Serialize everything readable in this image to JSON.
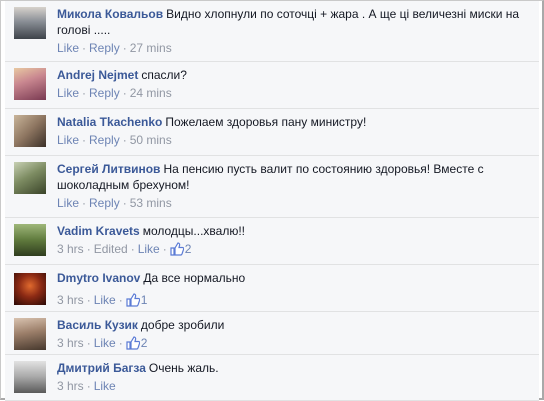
{
  "comments": [
    {
      "author": "Микола Ковальов",
      "text": "Видно хлопнули по соточці + жара . А ще ці величезні миски на голові .....",
      "meta": {
        "like": "Like",
        "reply": "Reply",
        "time": "27 mins"
      },
      "avatar_color": "#5a5f68",
      "avatar_icon": "person-photo-icon"
    },
    {
      "author": "Andrej Nejmet",
      "text": "спасли?",
      "meta": {
        "like": "Like",
        "reply": "Reply",
        "time": "24 mins"
      },
      "avatar_color": "#b56c7d",
      "avatar_icon": "person-photo-icon"
    },
    {
      "author": "Natalia Tkachenko",
      "text": "Пожелаем здоровья пану министру!",
      "meta": {
        "like": "Like",
        "reply": "Reply",
        "time": "50 mins"
      },
      "avatar_color": "#7c6a59",
      "avatar_icon": "person-photo-icon"
    },
    {
      "author": "Сергей Литвинов",
      "text": "На пенсию пусть валит по состоянию здоровья! Вместе с шоколадным брехуном!",
      "meta": {
        "like": "Like",
        "reply": "Reply",
        "time": "53 mins"
      },
      "avatar_color": "#6b7c55",
      "avatar_icon": "person-photo-icon"
    },
    {
      "author": "Vadim Kravets",
      "text": "молодцы...хвалю!!",
      "meta": {
        "time": "3 hrs",
        "edited": "Edited",
        "like": "Like",
        "like_count": "2"
      },
      "avatar_color": "#5f7a3d",
      "avatar_icon": "person-photo-icon"
    },
    {
      "author": "Dmytro Ivanov",
      "text": "Да все нормально",
      "meta": {
        "time": "3 hrs",
        "like": "Like",
        "like_count": "1"
      },
      "avatar_color": "#8c2a14",
      "avatar_icon": "person-photo-icon"
    },
    {
      "author": "Василь Кузик",
      "text": "добре зробили",
      "meta": {
        "time": "3 hrs",
        "like": "Like",
        "like_count": "2"
      },
      "avatar_color": "#6e5c4e",
      "avatar_icon": "person-photo-icon"
    },
    {
      "author": "Дмитрий Багза",
      "text": "Очень жаль.",
      "meta": {
        "time": "3 hrs",
        "like": "Like"
      },
      "avatar_color": "#9a9a9a",
      "avatar_icon": "person-photo-icon"
    }
  ],
  "colors": {
    "author_link": "#3b5998",
    "action_link": "#6d84b4",
    "meta_text": "#9197a3",
    "comment_bg": "#f6f7f9"
  },
  "icons": {
    "like_count": "thumbs-up-icon"
  }
}
